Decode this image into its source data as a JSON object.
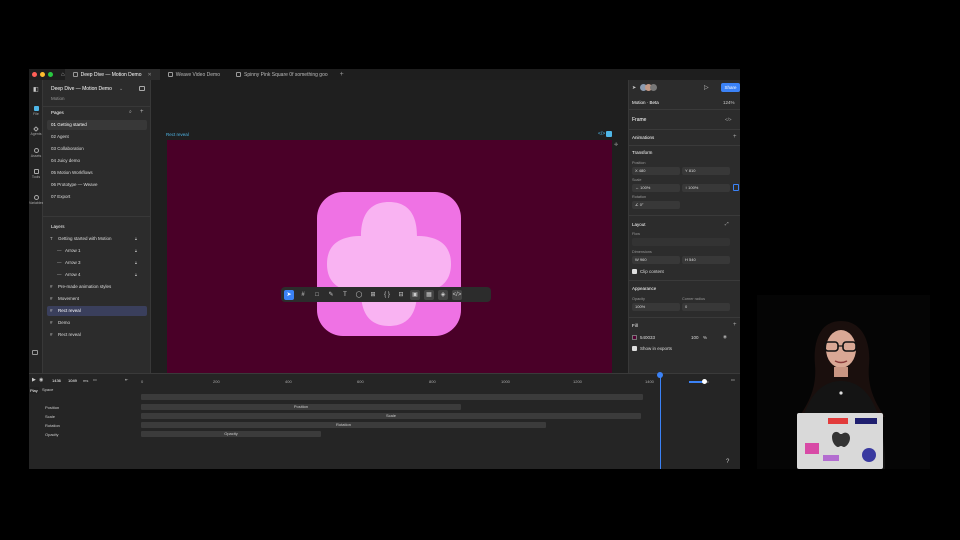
{
  "tabs": [
    {
      "label": "Deep Dive — Motion Demo",
      "active": true
    },
    {
      "label": "Weave Video Demo",
      "active": false
    },
    {
      "label": "Spinny Pink Square 0f something goo",
      "active": false
    }
  ],
  "rail": [
    "File",
    "Agents",
    "Assets",
    "Tools",
    "Variables"
  ],
  "project": {
    "title": "Deep Dive — Motion Demo",
    "subtitle": "Motion"
  },
  "pages": {
    "title": "Pages",
    "items": [
      "01 Getting started",
      "02 Agent",
      "03 Collaboration",
      "04 Juicy demo",
      "05 Motion Workflows",
      "06 Prototype — Weave",
      "07 Export"
    ],
    "selected": 0
  },
  "layers": {
    "title": "Layers",
    "items": [
      {
        "label": "Getting started with Motion",
        "indent": false,
        "icon": "T",
        "lock": true
      },
      {
        "label": "Arrow 1",
        "indent": true,
        "icon": "—",
        "lock": true
      },
      {
        "label": "Arrow 3",
        "indent": true,
        "icon": "—",
        "lock": true
      },
      {
        "label": "Arrow 4",
        "indent": true,
        "icon": "—",
        "lock": true
      },
      {
        "label": "Pre-made animation styles",
        "indent": false,
        "icon": "#",
        "lock": false
      },
      {
        "label": "Movement",
        "indent": false,
        "icon": "#",
        "lock": false
      },
      {
        "label": "Rect reveal",
        "indent": false,
        "icon": "#",
        "lock": false,
        "selected": true
      },
      {
        "label": "Demo",
        "indent": false,
        "icon": "#",
        "lock": false
      },
      {
        "label": "Rect reveal",
        "indent": false,
        "icon": "#",
        "lock": false
      }
    ]
  },
  "canvas": {
    "frame_label": "Rect reveal",
    "frame_color": "#4a0028",
    "tile_color": "#ef72e4",
    "blob_color": "#f9b3f2"
  },
  "right": {
    "doc_name": "Motion · Beta",
    "zoom": "124%",
    "share": "Share",
    "frame_label": "Frame",
    "animations": "Animations",
    "transform": "Transform",
    "position_label": "Position",
    "x": "480",
    "y": "810",
    "scale_label": "Scale",
    "scale_x": "100%",
    "scale_y": "100%",
    "rotation_label": "Rotation",
    "rotation": "0°",
    "layout": "Layout",
    "flow_label": "Flow",
    "dimensions_label": "Dimensions",
    "width": "960",
    "height": "540",
    "clip_content": "Clip content",
    "appearance": "Appearance",
    "opacity_label": "Opacity",
    "corner_label": "Corner radius",
    "opacity": "100%",
    "corner": "0",
    "fill": "Fill",
    "fill_hex": "540033",
    "fill_opacity": "100",
    "fill_pct": "%",
    "show_exports": "Show in exports"
  },
  "timeline": {
    "frame_count": "1436",
    "end_frame": "1049",
    "unit": "ms",
    "ticks": [
      "0",
      "200",
      "400",
      "600",
      "800",
      "1000",
      "1200",
      "1400"
    ],
    "play_label": "Play",
    "space_label": "Space",
    "tracks": [
      "Position",
      "Scale",
      "Rotation",
      "Opacity"
    ],
    "help": "?"
  },
  "speaker": {
    "laptop_stickers": [
      "#madeinFigma",
      "DSF",
      "EXO"
    ]
  }
}
